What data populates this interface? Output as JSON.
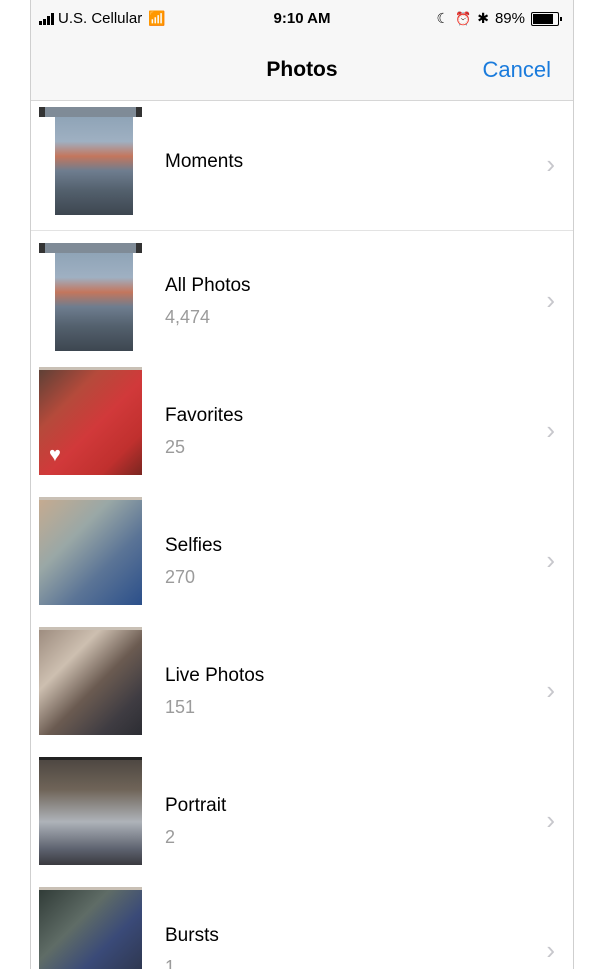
{
  "status_bar": {
    "carrier": "U.S. Cellular",
    "time": "9:10 AM",
    "battery_percent": "89%",
    "battery_level": 0.89
  },
  "nav": {
    "title": "Photos",
    "cancel_label": "Cancel"
  },
  "albums": [
    {
      "label": "Moments",
      "count": ""
    },
    {
      "label": "All Photos",
      "count": "4,474"
    },
    {
      "label": "Favorites",
      "count": "25"
    },
    {
      "label": "Selfies",
      "count": "270"
    },
    {
      "label": "Live Photos",
      "count": "151"
    },
    {
      "label": "Portrait",
      "count": "2"
    },
    {
      "label": "Bursts",
      "count": "1"
    }
  ],
  "icons": {
    "chevron": "chevron-right-icon",
    "favorite": "heart-icon"
  },
  "colors": {
    "accent": "#1a7bdc",
    "secondary_text": "#9b9b9b"
  }
}
